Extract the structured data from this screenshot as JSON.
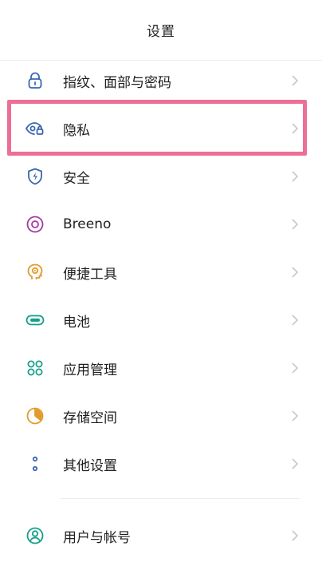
{
  "header": {
    "title": "设置"
  },
  "items": [
    {
      "label": "指纹、面部与密码",
      "icon": "lock-icon",
      "color": "#3b66b3"
    },
    {
      "label": "隐私",
      "icon": "eye-lock-icon",
      "color": "#3b66b3"
    },
    {
      "label": "安全",
      "icon": "shield-bolt-icon",
      "color": "#3b66b3"
    },
    {
      "label": "Breeno",
      "icon": "breeno-ring-icon",
      "color": "#a33aa3"
    },
    {
      "label": "便捷工具",
      "icon": "head-idea-icon",
      "color": "#e39a2b"
    },
    {
      "label": "电池",
      "icon": "battery-icon",
      "color": "#15a088"
    },
    {
      "label": "应用管理",
      "icon": "apps-grid-icon",
      "color": "#15a088"
    },
    {
      "label": "存储空间",
      "icon": "storage-pie-icon",
      "color": "#e39a2b"
    },
    {
      "label": "其他设置",
      "icon": "dots-icon",
      "color": "#3b66b3"
    },
    {
      "label": "用户与帐号",
      "icon": "user-icon",
      "color": "#15a088"
    }
  ],
  "colors": {
    "highlight": "#ec6f95",
    "chevron": "#c8c8c8",
    "divider": "#ececec"
  }
}
